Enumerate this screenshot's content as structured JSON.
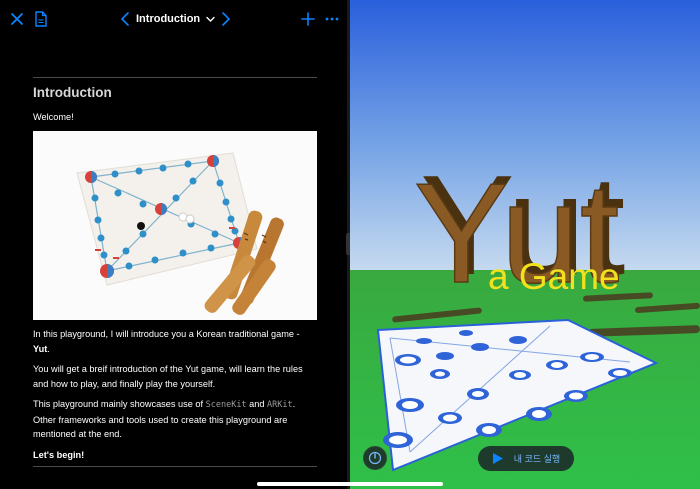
{
  "header": {
    "title": "Introduction",
    "icons": {
      "close": "close-icon",
      "document": "document-icon",
      "back": "chevron-left-icon",
      "forward": "chevron-right-icon",
      "dropdown": "chevron-down-icon",
      "add": "plus-icon",
      "more": "ellipsis-icon"
    }
  },
  "page": {
    "heading": "Introduction",
    "welcome": "Welcome!",
    "para1_pre": "In this playground, I will introduce you a Korean traditional game - ",
    "para1_bold": "Yut",
    "para1_post": ".",
    "para2": "You will get a breif introduction of the Yut game, will learn the rules and how to play, and finally play the yourself.",
    "para3_pre": "This playground mainly showcases use of ",
    "para3_code1": "SceneKit",
    "para3_mid": " and ",
    "para3_code2": "ARKit",
    "para3_post": ". Other frameworks and tools used to create this playground are mentioned at the end.",
    "para4": "Let's begin!"
  },
  "scene": {
    "title_3d": "Yut",
    "subtitle": "a Game",
    "run_button": "내 코드 실행"
  },
  "colors": {
    "accent": "#0a84ff",
    "sky_top": "#2f66dd",
    "grass": "#2fb845",
    "subtitle": "#f2e21e",
    "wood": "#6b4a22"
  }
}
